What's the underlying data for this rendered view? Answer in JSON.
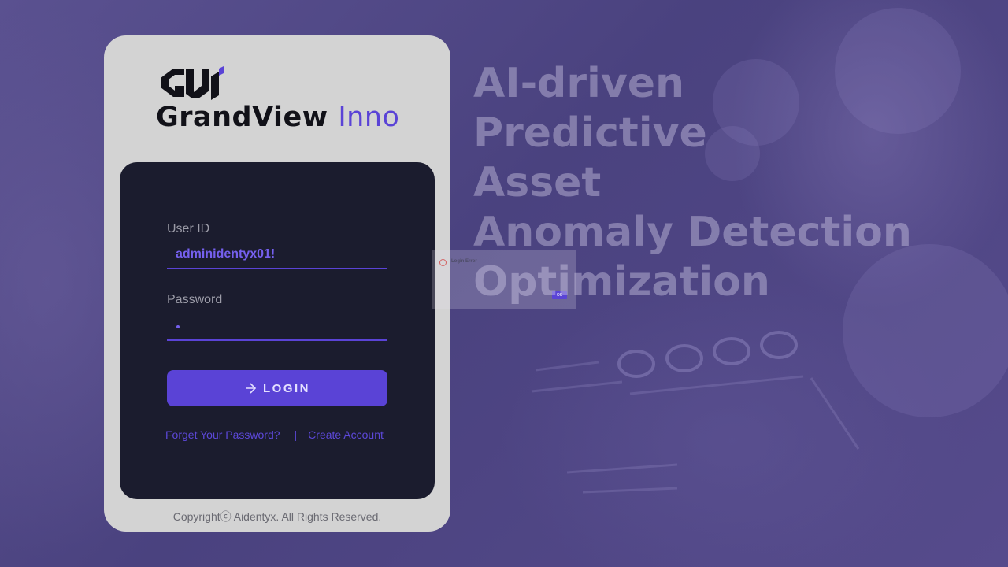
{
  "brand": {
    "name_main": "GrandView",
    "name_accent": "Inno",
    "logo_icon": "gwi-logo-icon"
  },
  "login_form": {
    "user_id_label": "User ID",
    "user_id_value": "adminidentyx01!",
    "password_label": "Password",
    "password_value_masked": "•",
    "login_button_label": "LOGIN",
    "login_button_icon": "arrow-right-icon",
    "forgot_password_link": "Forget Your Password?",
    "link_separator": "|",
    "create_account_link": "Create Account"
  },
  "footer": {
    "copyright": "Copyrightⓒ Aidentyx. All Rights Reserved."
  },
  "hero": {
    "lines": [
      "AI-driven",
      "Predictive",
      "Asset",
      "Anomaly Detection",
      "Optimization"
    ]
  },
  "error_dialog": {
    "title": "Login Error",
    "message": "",
    "ok_label": "OK"
  },
  "colors": {
    "accent": "#5a43d6",
    "panel": "#1b1c2e",
    "card": "#d3d3d3",
    "background": "#4f4685"
  }
}
